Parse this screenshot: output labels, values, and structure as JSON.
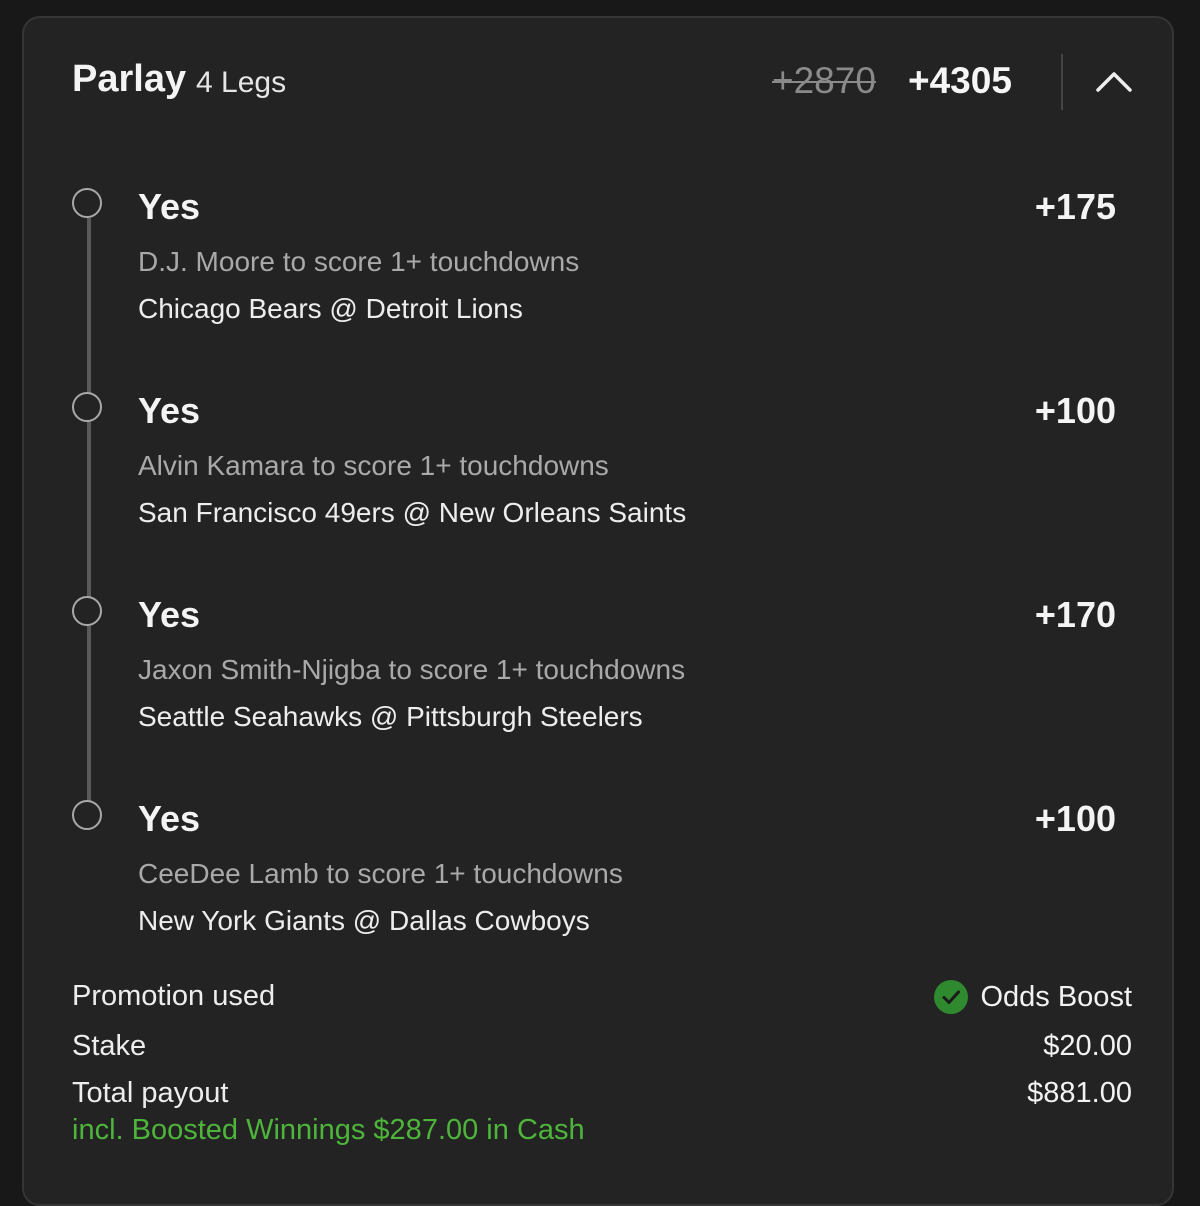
{
  "header": {
    "title": "Parlay",
    "legs_label": "4 Legs",
    "original_odds": "+2870",
    "boosted_odds": "+4305"
  },
  "legs": [
    {
      "selection": "Yes",
      "odds": "+175",
      "market": "D.J. Moore to score 1+ touchdowns",
      "event": "Chicago Bears @ Detroit Lions"
    },
    {
      "selection": "Yes",
      "odds": "+100",
      "market": "Alvin Kamara to score 1+ touchdowns",
      "event": "San Francisco 49ers @ New Orleans Saints"
    },
    {
      "selection": "Yes",
      "odds": "+170",
      "market": "Jaxon Smith-Njigba to score 1+ touchdowns",
      "event": "Seattle Seahawks @ Pittsburgh Steelers"
    },
    {
      "selection": "Yes",
      "odds": "+100",
      "market": "CeeDee Lamb to score 1+ touchdowns",
      "event": "New York Giants @ Dallas Cowboys"
    }
  ],
  "summary": {
    "promotion_label": "Promotion used",
    "promotion_value": "Odds Boost",
    "stake_label": "Stake",
    "stake_value": "$20.00",
    "payout_label": "Total payout",
    "payout_value": "$881.00",
    "boost_note": "incl. Boosted Winnings $287.00 in Cash"
  },
  "icons": {
    "collapse": "chevron-up-icon",
    "promotion": "check-circle-icon"
  },
  "colors": {
    "background": "#232323",
    "accent_green": "#4cb53a",
    "check_green": "#2f8a2f"
  }
}
